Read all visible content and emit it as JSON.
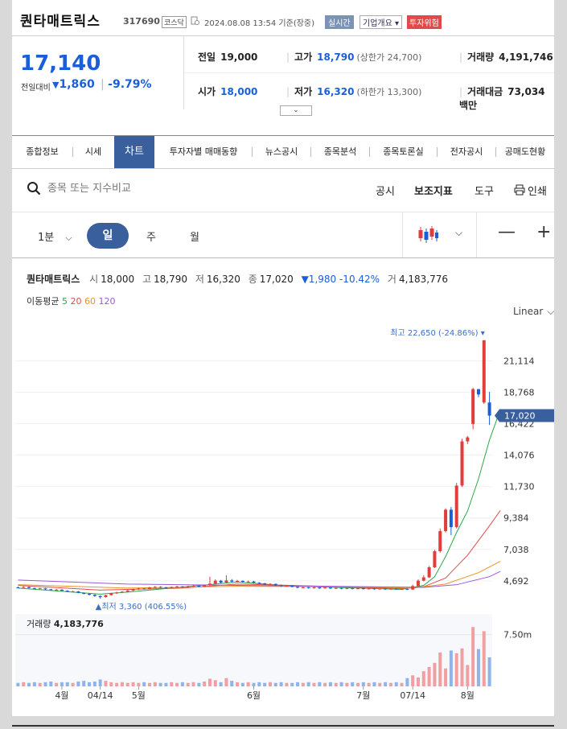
{
  "header": {
    "stock_name": "퀀타매트릭스",
    "stock_code": "317690",
    "market": "코스닥",
    "timestamp": "2024.08.08 13:54 기준(장중)",
    "realtime_badge": "실시간",
    "company_select": "기업개요",
    "risk_badge": "투자위험"
  },
  "price": {
    "current": "17,140",
    "change_label": "전일대비",
    "change": "1,860",
    "change_pct": "-9.79%"
  },
  "stats": {
    "prev_close_label": "전일",
    "prev_close": "19,000",
    "high_label": "고가",
    "high": "18,790",
    "upper_limit": "(상한가 24,700)",
    "volume_label": "거래량",
    "volume": "4,191,746",
    "open_label": "시가",
    "open": "18,000",
    "low_label": "저가",
    "low": "16,320",
    "lower_limit": "(하한가 13,300)",
    "amount_label": "거래대금",
    "amount": "73,034 백만"
  },
  "tabs": [
    "종합정보",
    "시세",
    "차트",
    "투자자별 매매동향",
    "뉴스공시",
    "종목분석",
    "종목토론실",
    "전자공시",
    "공매도현황"
  ],
  "active_tab": "차트",
  "search": {
    "placeholder": "종목 또는 지수비교",
    "tools": [
      "공시",
      "보조지표",
      "도구",
      "인쇄"
    ]
  },
  "periods": {
    "minute": "1분",
    "day": "일",
    "week": "주",
    "month": "월"
  },
  "chart_info": {
    "name": "퀀타매트릭스",
    "open_label": "시",
    "open": "18,000",
    "high_label": "고",
    "high": "18,790",
    "low_label": "저",
    "low": "16,320",
    "close_label": "종",
    "close": "17,020",
    "change": "▼1,980 -10.42%",
    "volume_label": "거",
    "volume": "4,183,776",
    "ma_label": "이동평균",
    "ma": [
      {
        "period": "5",
        "color": "#2aa84a"
      },
      {
        "period": "20",
        "color": "#e24a4a"
      },
      {
        "period": "60",
        "color": "#e8952a"
      },
      {
        "period": "120",
        "color": "#9a5ad6"
      }
    ],
    "scale": "Linear",
    "max_label": "최고 22,650 (-24.86%)",
    "min_label": "최저 3,360 (406.55%)",
    "last_price_tag": "17,020",
    "volume_panel_label": "거래량",
    "volume_panel_value": "4,183,776"
  },
  "chart_data": {
    "type": "candlestick",
    "y_ticks": [
      "21,114",
      "18,768",
      "16,422",
      "14,076",
      "11,730",
      "9,384",
      "7,038",
      "4,692"
    ],
    "x_ticks": [
      "4월",
      "04/14",
      "5월",
      "6월",
      "7월",
      "07/14",
      "8월"
    ],
    "volume_tick": "7.50m",
    "ylim": [
      3360,
      22650
    ],
    "colors": {
      "up": "#e23d3d",
      "down": "#1a5fd8"
    },
    "candles": [
      {
        "o": 4200,
        "c": 4180,
        "h": 4260,
        "l": 4140
      },
      {
        "o": 4180,
        "c": 4230,
        "h": 4280,
        "l": 4150
      },
      {
        "o": 4230,
        "c": 4150,
        "h": 4260,
        "l": 4120
      },
      {
        "o": 4150,
        "c": 4090,
        "h": 4190,
        "l": 4060
      },
      {
        "o": 4090,
        "c": 4130,
        "h": 4170,
        "l": 4060
      },
      {
        "o": 4130,
        "c": 4060,
        "h": 4160,
        "l": 4020
      },
      {
        "o": 4060,
        "c": 4000,
        "h": 4090,
        "l": 3960
      },
      {
        "o": 4000,
        "c": 4030,
        "h": 4080,
        "l": 3970
      },
      {
        "o": 4030,
        "c": 3950,
        "h": 4060,
        "l": 3920
      },
      {
        "o": 3950,
        "c": 3880,
        "h": 3990,
        "l": 3850
      },
      {
        "o": 3880,
        "c": 3900,
        "h": 3940,
        "l": 3840
      },
      {
        "o": 3900,
        "c": 3800,
        "h": 3930,
        "l": 3770
      },
      {
        "o": 3800,
        "c": 3720,
        "h": 3820,
        "l": 3680
      },
      {
        "o": 3720,
        "c": 3650,
        "h": 3760,
        "l": 3600
      },
      {
        "o": 3650,
        "c": 3560,
        "h": 3680,
        "l": 3500
      },
      {
        "o": 3560,
        "c": 3470,
        "h": 3590,
        "l": 3360
      },
      {
        "o": 3470,
        "c": 3620,
        "h": 3660,
        "l": 3440
      },
      {
        "o": 3620,
        "c": 3760,
        "h": 3800,
        "l": 3590
      },
      {
        "o": 3760,
        "c": 3820,
        "h": 3880,
        "l": 3720
      },
      {
        "o": 3820,
        "c": 3880,
        "h": 3920,
        "l": 3780
      },
      {
        "o": 3880,
        "c": 3960,
        "h": 4010,
        "l": 3850
      },
      {
        "o": 3960,
        "c": 4050,
        "h": 4100,
        "l": 3930
      },
      {
        "o": 4050,
        "c": 4120,
        "h": 4180,
        "l": 4010
      },
      {
        "o": 4120,
        "c": 4090,
        "h": 4160,
        "l": 4040
      },
      {
        "o": 4090,
        "c": 4190,
        "h": 4240,
        "l": 4060
      },
      {
        "o": 4190,
        "c": 4240,
        "h": 4290,
        "l": 4150
      },
      {
        "o": 4240,
        "c": 4200,
        "h": 4280,
        "l": 4160
      },
      {
        "o": 4200,
        "c": 4160,
        "h": 4230,
        "l": 4120
      },
      {
        "o": 4160,
        "c": 4230,
        "h": 4270,
        "l": 4130
      },
      {
        "o": 4230,
        "c": 4270,
        "h": 4320,
        "l": 4190
      },
      {
        "o": 4270,
        "c": 4210,
        "h": 4300,
        "l": 4180
      },
      {
        "o": 4210,
        "c": 4290,
        "h": 4330,
        "l": 4180
      },
      {
        "o": 4290,
        "c": 4320,
        "h": 4380,
        "l": 4250
      },
      {
        "o": 4320,
        "c": 4260,
        "h": 4350,
        "l": 4230
      },
      {
        "o": 4260,
        "c": 4380,
        "h": 4420,
        "l": 4230
      },
      {
        "o": 4380,
        "c": 4480,
        "h": 5000,
        "l": 4340
      },
      {
        "o": 4480,
        "c": 4700,
        "h": 4800,
        "l": 4420
      },
      {
        "o": 4700,
        "c": 4560,
        "h": 4760,
        "l": 4500
      },
      {
        "o": 4560,
        "c": 4720,
        "h": 5100,
        "l": 4520
      },
      {
        "o": 4720,
        "c": 4640,
        "h": 4820,
        "l": 4580
      },
      {
        "o": 4640,
        "c": 4690,
        "h": 4760,
        "l": 4600
      },
      {
        "o": 4690,
        "c": 4610,
        "h": 4720,
        "l": 4560
      },
      {
        "o": 4610,
        "c": 4640,
        "h": 4700,
        "l": 4570
      },
      {
        "o": 4640,
        "c": 4550,
        "h": 4680,
        "l": 4500
      },
      {
        "o": 4550,
        "c": 4500,
        "h": 4590,
        "l": 4450
      },
      {
        "o": 4500,
        "c": 4420,
        "h": 4540,
        "l": 4380
      },
      {
        "o": 4420,
        "c": 4460,
        "h": 4510,
        "l": 4370
      },
      {
        "o": 4460,
        "c": 4360,
        "h": 4490,
        "l": 4320
      },
      {
        "o": 4360,
        "c": 4300,
        "h": 4400,
        "l": 4250
      },
      {
        "o": 4300,
        "c": 4330,
        "h": 4380,
        "l": 4260
      },
      {
        "o": 4330,
        "c": 4240,
        "h": 4360,
        "l": 4200
      },
      {
        "o": 4240,
        "c": 4180,
        "h": 4280,
        "l": 4130
      },
      {
        "o": 4180,
        "c": 4210,
        "h": 4260,
        "l": 4140
      },
      {
        "o": 4210,
        "c": 4150,
        "h": 4240,
        "l": 4100
      },
      {
        "o": 4150,
        "c": 4200,
        "h": 4250,
        "l": 4110
      },
      {
        "o": 4200,
        "c": 4130,
        "h": 4230,
        "l": 4090
      },
      {
        "o": 4130,
        "c": 4190,
        "h": 4240,
        "l": 4100
      },
      {
        "o": 4190,
        "c": 4120,
        "h": 4220,
        "l": 4080
      },
      {
        "o": 4120,
        "c": 4160,
        "h": 4210,
        "l": 4090
      },
      {
        "o": 4160,
        "c": 4100,
        "h": 4190,
        "l": 4060
      },
      {
        "o": 4100,
        "c": 4150,
        "h": 4200,
        "l": 4070
      },
      {
        "o": 4150,
        "c": 4090,
        "h": 4180,
        "l": 4050
      },
      {
        "o": 4090,
        "c": 4130,
        "h": 4180,
        "l": 4060
      },
      {
        "o": 4130,
        "c": 4080,
        "h": 4160,
        "l": 4040
      },
      {
        "o": 4080,
        "c": 4120,
        "h": 4170,
        "l": 4050
      },
      {
        "o": 4120,
        "c": 4070,
        "h": 4150,
        "l": 4030
      },
      {
        "o": 4070,
        "c": 4110,
        "h": 4160,
        "l": 4040
      },
      {
        "o": 4110,
        "c": 4060,
        "h": 4140,
        "l": 4020
      },
      {
        "o": 4060,
        "c": 4100,
        "h": 4150,
        "l": 4030
      },
      {
        "o": 4100,
        "c": 4050,
        "h": 4130,
        "l": 4010
      },
      {
        "o": 4050,
        "c": 4090,
        "h": 4140,
        "l": 4020
      },
      {
        "o": 4090,
        "c": 4040,
        "h": 4120,
        "l": 4000
      },
      {
        "o": 4040,
        "c": 4300,
        "h": 4400,
        "l": 4020
      },
      {
        "o": 4300,
        "c": 4700,
        "h": 4800,
        "l": 4250
      },
      {
        "o": 4700,
        "c": 4950,
        "h": 5100,
        "l": 4650
      },
      {
        "o": 4950,
        "c": 5700,
        "h": 5800,
        "l": 4900
      },
      {
        "o": 5700,
        "c": 6900,
        "h": 7000,
        "l": 5650
      },
      {
        "o": 6900,
        "c": 8400,
        "h": 8600,
        "l": 6800
      },
      {
        "o": 8400,
        "c": 10000,
        "h": 10100,
        "l": 8300
      },
      {
        "o": 10000,
        "c": 8700,
        "h": 10200,
        "l": 8100
      },
      {
        "o": 8700,
        "c": 11800,
        "h": 12000,
        "l": 8600
      },
      {
        "o": 11800,
        "c": 15100,
        "h": 15300,
        "l": 11700
      },
      {
        "o": 15100,
        "c": 15400,
        "h": 15500,
        "l": 14900
      },
      {
        "o": 16400,
        "c": 19000,
        "h": 19100,
        "l": 16000
      },
      {
        "o": 19000,
        "c": 18600,
        "h": 19000,
        "l": 18400
      },
      {
        "o": 18000,
        "c": 22650,
        "h": 22650,
        "l": 17900
      },
      {
        "o": 18000,
        "c": 17020,
        "h": 18790,
        "l": 16320
      }
    ],
    "volumes_m": [
      0.5,
      0.6,
      0.5,
      0.6,
      0.5,
      0.6,
      0.7,
      0.5,
      0.6,
      0.6,
      0.5,
      0.7,
      0.8,
      0.6,
      0.7,
      1.0,
      0.8,
      0.6,
      0.5,
      0.6,
      0.5,
      0.6,
      0.5,
      0.6,
      0.5,
      0.6,
      0.5,
      0.5,
      0.6,
      0.5,
      0.6,
      0.5,
      0.6,
      0.5,
      0.7,
      1.1,
      0.9,
      0.6,
      1.2,
      0.8,
      0.6,
      0.5,
      0.6,
      0.5,
      0.6,
      0.5,
      0.6,
      0.5,
      0.6,
      0.5,
      0.5,
      0.6,
      0.5,
      0.6,
      0.5,
      0.6,
      0.5,
      0.6,
      0.5,
      0.6,
      0.5,
      0.6,
      0.5,
      0.6,
      0.5,
      0.6,
      0.5,
      0.6,
      0.5,
      0.6,
      0.5,
      1.2,
      1.6,
      1.3,
      2.2,
      2.8,
      3.4,
      4.9,
      2.6,
      5.2,
      4.8,
      5.5,
      3.1,
      8.6,
      5.4,
      8.0,
      4.2
    ],
    "ma_lines": {
      "ma5": [
        [
          0,
          4150
        ],
        [
          15,
          3700
        ],
        [
          20,
          3850
        ],
        [
          30,
          4230
        ],
        [
          40,
          4600
        ],
        [
          50,
          4300
        ],
        [
          70,
          4050
        ],
        [
          74,
          4350
        ],
        [
          76,
          5000
        ],
        [
          78,
          6500
        ],
        [
          80,
          8300
        ],
        [
          82,
          9900
        ],
        [
          84,
          12300
        ],
        [
          86,
          15200
        ],
        [
          88,
          17500
        ]
      ],
      "ma20": [
        [
          0,
          4350
        ],
        [
          15,
          4000
        ],
        [
          30,
          4150
        ],
        [
          40,
          4450
        ],
        [
          50,
          4350
        ],
        [
          70,
          4100
        ],
        [
          74,
          4250
        ],
        [
          78,
          4900
        ],
        [
          82,
          6600
        ],
        [
          86,
          8800
        ],
        [
          88,
          9950
        ]
      ],
      "ma60": [
        [
          0,
          4400
        ],
        [
          20,
          4150
        ],
        [
          40,
          4280
        ],
        [
          60,
          4250
        ],
        [
          72,
          4150
        ],
        [
          78,
          4450
        ],
        [
          84,
          5300
        ],
        [
          88,
          6150
        ]
      ],
      "ma120": [
        [
          0,
          4750
        ],
        [
          20,
          4450
        ],
        [
          40,
          4350
        ],
        [
          60,
          4270
        ],
        [
          74,
          4200
        ],
        [
          80,
          4400
        ],
        [
          86,
          5000
        ],
        [
          88,
          5400
        ]
      ]
    }
  }
}
